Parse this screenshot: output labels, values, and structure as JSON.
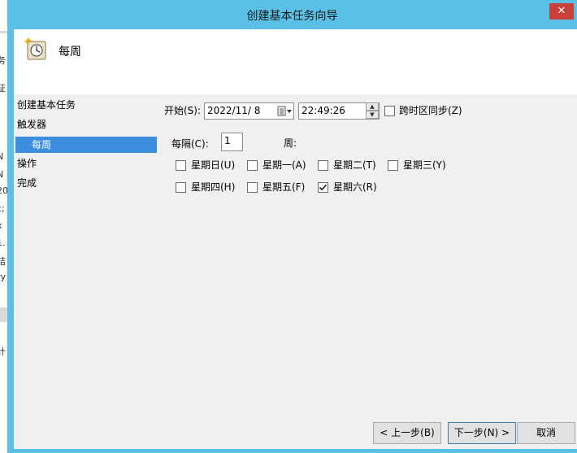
{
  "window": {
    "title": "创建基本任务向导",
    "close_icon": "✕"
  },
  "header": {
    "title": "每周",
    "icon": "scheduled-task-icon"
  },
  "nav": [
    {
      "label": "创建基本任务"
    },
    {
      "label": "触发器"
    },
    {
      "label": "每周",
      "selected": true
    },
    {
      "label": "操作"
    },
    {
      "label": "完成"
    }
  ],
  "form": {
    "start_label": "开始(S):",
    "date_value": "2022/11/ 8",
    "time_value": "22:49:26",
    "sync_tz_label": "跨时区同步(Z)",
    "sync_tz_checked": false,
    "recur_label": "每隔(C):",
    "recur_value": "1",
    "recur_unit": "周:",
    "days": [
      {
        "label": "星期日(U)",
        "checked": false
      },
      {
        "label": "星期一(A)",
        "checked": false
      },
      {
        "label": "星期二(T)",
        "checked": false
      },
      {
        "label": "星期三(Y)",
        "checked": false
      },
      {
        "label": "星期四(H)",
        "checked": false
      },
      {
        "label": "星期五(F)",
        "checked": false
      },
      {
        "label": "星期六(R)",
        "checked": true
      }
    ]
  },
  "buttons": {
    "back": "< 上一步(B)",
    "next": "下一步(N) >",
    "cancel": "取消"
  },
  "background_fragments": [
    "务",
    "证",
    "N",
    "N",
    "20",
    "c;",
    "x",
    "1.",
    "结",
    "ry",
    "计"
  ],
  "colors": {
    "titlebar": "#5bc0e5",
    "selected_nav": "#3b8de0",
    "close": "#c9403a"
  }
}
